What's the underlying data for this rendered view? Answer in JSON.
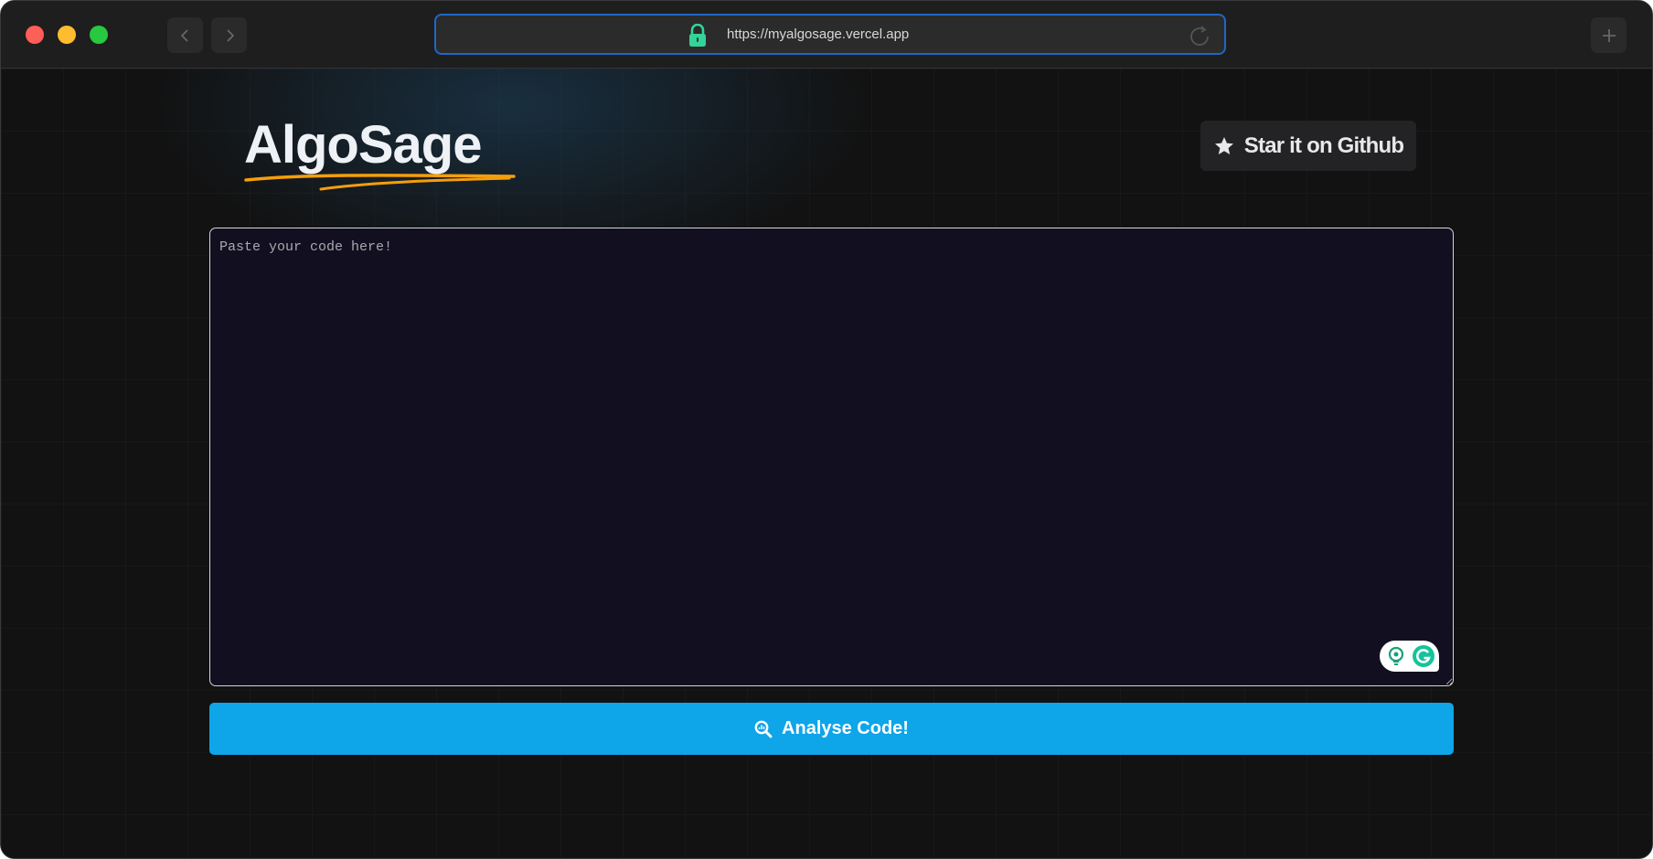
{
  "browser": {
    "url": "https://myalgosage.vercel.app"
  },
  "header": {
    "brand": "AlgoSage",
    "github_label": "Star it on Github"
  },
  "editor": {
    "placeholder": "Paste your code here!",
    "value": ""
  },
  "actions": {
    "analyse_label": "Analyse Code!"
  },
  "icons": {
    "lock": "lock-icon",
    "reload": "reload-icon",
    "star": "star-icon",
    "search": "magnifier-chart-icon",
    "grammarly": "grammarly-icon"
  },
  "colors": {
    "accent_button": "#0ea5e9",
    "brand_underline": "#f59e0b",
    "lock": "#34d399",
    "urlbar_border": "#1f67c5",
    "editor_bg": "#121020"
  }
}
